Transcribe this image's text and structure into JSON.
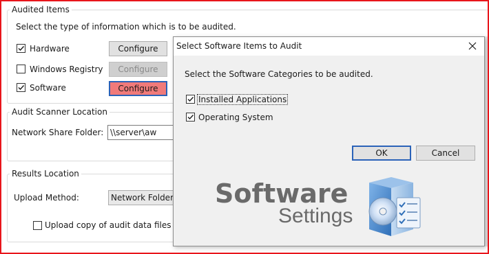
{
  "audited_items": {
    "legend": "Audited Items",
    "instruction": "Select the type of information which is to be audited.",
    "items": [
      {
        "label": "Hardware",
        "checked": true,
        "button": "Configure",
        "button_state": "normal"
      },
      {
        "label": "Windows Registry",
        "checked": false,
        "button": "Configure",
        "button_state": "disabled"
      },
      {
        "label": "Software",
        "checked": true,
        "button": "Configure",
        "button_state": "highlighted"
      }
    ]
  },
  "scanner_location": {
    "legend": "Audit Scanner Location",
    "field_label": "Network Share Folder:",
    "field_value": "\\\\server\\aw"
  },
  "results_location": {
    "legend": "Results Location",
    "method_label": "Upload Method:",
    "method_value": "Network Folder",
    "upload_copy_label": "Upload copy of audit data files",
    "upload_copy_checked": false
  },
  "dialog": {
    "title": "Select Software Items to Audit",
    "instruction": "Select the Software Categories to be audited.",
    "options": [
      {
        "label": "Installed Applications",
        "checked": true
      },
      {
        "label": "Operating System",
        "checked": true
      }
    ],
    "ok_label": "OK",
    "cancel_label": "Cancel"
  },
  "logo": {
    "title": "Software",
    "subtitle": "Settings"
  },
  "colors": {
    "frame_border": "#e8151b",
    "highlight_button": "#f07a7a",
    "focus_border": "#2a62b8"
  }
}
